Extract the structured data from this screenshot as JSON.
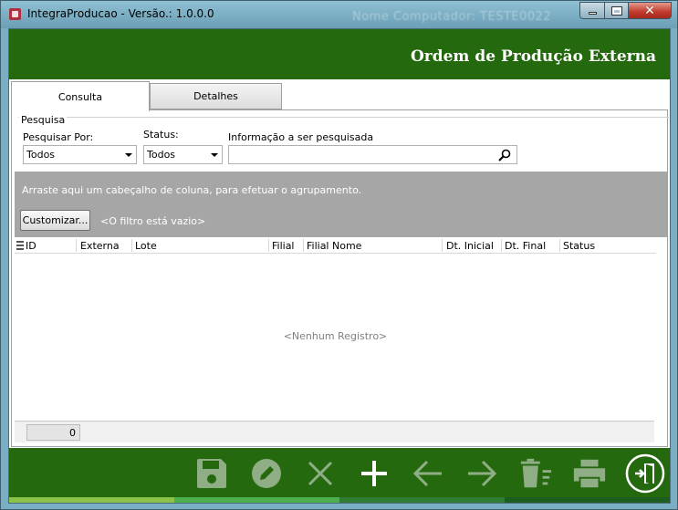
{
  "window": {
    "title": "IntegraProducao - Versão.: 1.0.0.0",
    "ghost_text": "Nome Computador: TESTE0022"
  },
  "header": {
    "title": "Ordem de Produção Externa"
  },
  "tabs": [
    {
      "label": "Consulta"
    },
    {
      "label": "Detalhes"
    }
  ],
  "pesquisa": {
    "group_label": "Pesquisa",
    "pesquisar_por_label": "Pesquisar Por:",
    "pesquisar_por_value": "Todos",
    "status_label": "Status:",
    "status_value": "Todos",
    "info_label": "Informação a ser pesquisada",
    "info_value": ""
  },
  "grid": {
    "group_hint": "Arraste aqui um cabeçalho de coluna, para efetuar o agrupamento.",
    "customize_label": "Customizar...",
    "filter_text": "<O filtro está vazio>",
    "columns": [
      "ID",
      "Externa",
      "Lote",
      "Filial",
      "Filial Nome",
      "Dt. Inicial",
      "Dt. Final",
      "Status"
    ],
    "empty_text": "<Nenhum Registro>",
    "footer_count": "0"
  },
  "toolbar": {
    "icons": [
      "save-icon",
      "edit-icon",
      "cancel-icon",
      "add-icon",
      "previous-icon",
      "next-icon",
      "delete-icon",
      "print-icon",
      "exit-icon"
    ]
  },
  "colors": {
    "header_green": "#25690f",
    "strip": [
      "#8bc34a",
      "#4caf50",
      "#2e7d32",
      "#1b5e20"
    ]
  }
}
